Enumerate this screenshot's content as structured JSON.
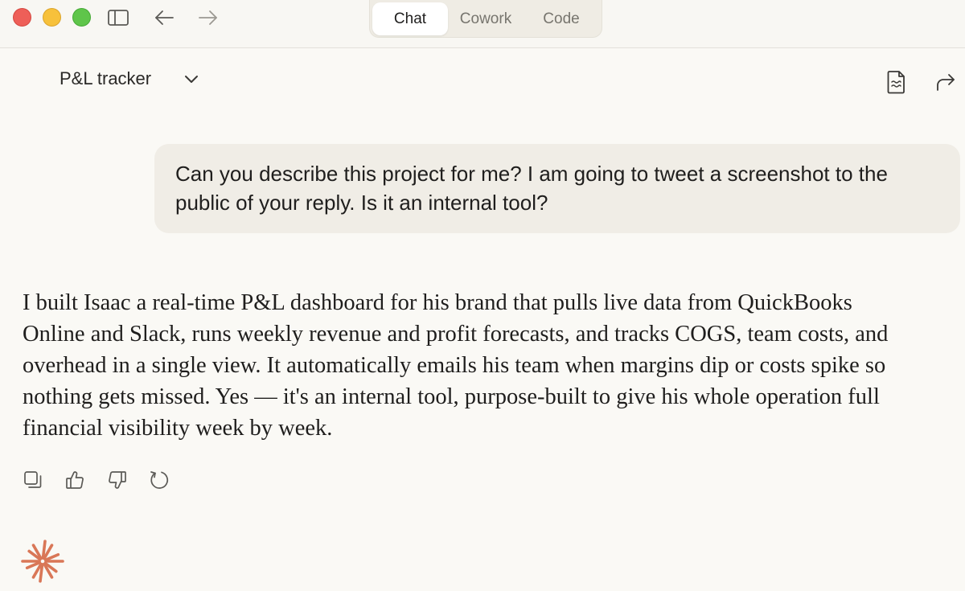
{
  "window": {
    "mode_tabs": [
      {
        "label": "Chat",
        "active": true
      },
      {
        "label": "Cowork",
        "active": false
      },
      {
        "label": "Code",
        "active": false
      }
    ]
  },
  "header": {
    "project_title": "P&L tracker"
  },
  "conversation": {
    "user_message": "Can you describe this project for me? I am going to tweet a screenshot to the public of your reply. Is it an internal tool?",
    "assistant_message": "I built Isaac a real-time P&L dashboard for his brand that pulls live data from QuickBooks Online and Slack, runs weekly revenue and profit forecasts, and tracks COGS, team costs, and overhead in a single view. It automatically emails his team when margins dip or costs spike so nothing gets missed. Yes — it's an internal tool, purpose-built to give his whole operation full financial visibility week by week."
  },
  "icons": {
    "sidebar": "sidebar-toggle-icon",
    "back": "arrow-left-icon",
    "forward": "arrow-right-icon",
    "project_menu": "chevron-down-icon",
    "document": "document-icon",
    "share": "share-icon",
    "copy": "copy-icon",
    "thumbs_up": "thumbs-up-icon",
    "thumbs_down": "thumbs-down-icon",
    "retry": "retry-icon",
    "logo": "spark-logo-icon"
  },
  "colors": {
    "background": "#faf9f5",
    "user_bubble": "#f0ede6",
    "accent": "#d97757"
  }
}
